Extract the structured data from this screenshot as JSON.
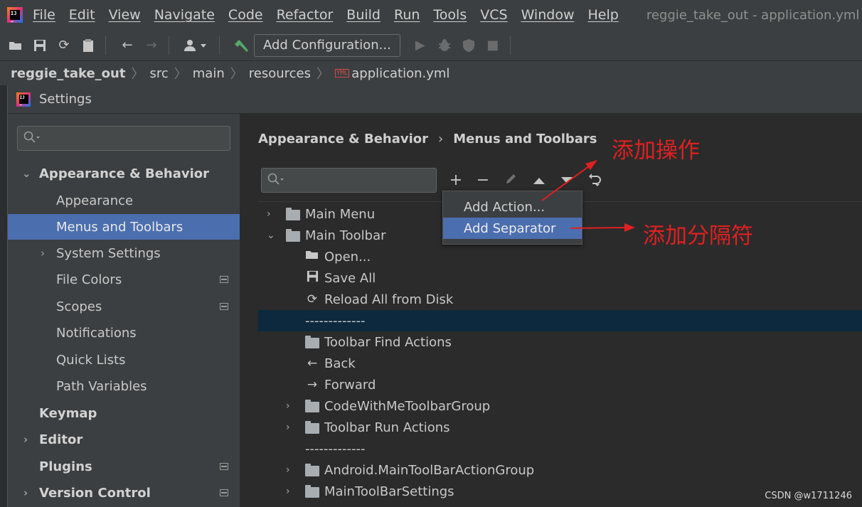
{
  "menubar": {
    "items": [
      "File",
      "Edit",
      "View",
      "Navigate",
      "Code",
      "Refactor",
      "Build",
      "Run",
      "Tools",
      "VCS",
      "Window",
      "Help"
    ],
    "window_title": "reggie_take_out - application.yml"
  },
  "toolbar": {
    "add_configuration": "Add Configuration..."
  },
  "navbar": {
    "project": "reggie_take_out",
    "path": [
      "src",
      "main",
      "resources"
    ],
    "file_badge": "YML",
    "file": "application.yml"
  },
  "dialog": {
    "title": "Settings"
  },
  "sidebar": {
    "search_placeholder": "",
    "items": [
      {
        "label": "Appearance & Behavior"
      },
      {
        "label": "Appearance"
      },
      {
        "label": "Menus and Toolbars"
      },
      {
        "label": "System Settings"
      },
      {
        "label": "File Colors"
      },
      {
        "label": "Scopes"
      },
      {
        "label": "Notifications"
      },
      {
        "label": "Quick Lists"
      },
      {
        "label": "Path Variables"
      },
      {
        "label": "Keymap"
      },
      {
        "label": "Editor"
      },
      {
        "label": "Plugins"
      },
      {
        "label": "Version Control"
      }
    ]
  },
  "content": {
    "breadcrumb": [
      "Appearance & Behavior",
      "Menus and Toolbars"
    ],
    "tree": [
      {
        "label": "Main Menu"
      },
      {
        "label": "Main Toolbar"
      },
      {
        "label": "Open..."
      },
      {
        "label": "Save All"
      },
      {
        "label": "Reload All from Disk"
      },
      {
        "label": "-------------"
      },
      {
        "label": "Toolbar Find Actions"
      },
      {
        "label": "Back"
      },
      {
        "label": "Forward"
      },
      {
        "label": "CodeWithMeToolbarGroup"
      },
      {
        "label": "Toolbar Run Actions"
      },
      {
        "label": "-------------"
      },
      {
        "label": "Android.MainToolBarActionGroup"
      },
      {
        "label": "MainToolBarSettings"
      }
    ]
  },
  "popup": {
    "items": [
      "Add Action...",
      "Add Separator"
    ]
  },
  "annotations": {
    "add_action": "添加操作",
    "add_separator": "添加分隔符",
    "color": "#e02020"
  },
  "watermark": "CSDN @w1711246",
  "colors": {
    "selection": "#4b6eaf",
    "highlight_row": "#0d293e",
    "panel": "#3c3f41",
    "background": "#2b2b2b"
  }
}
